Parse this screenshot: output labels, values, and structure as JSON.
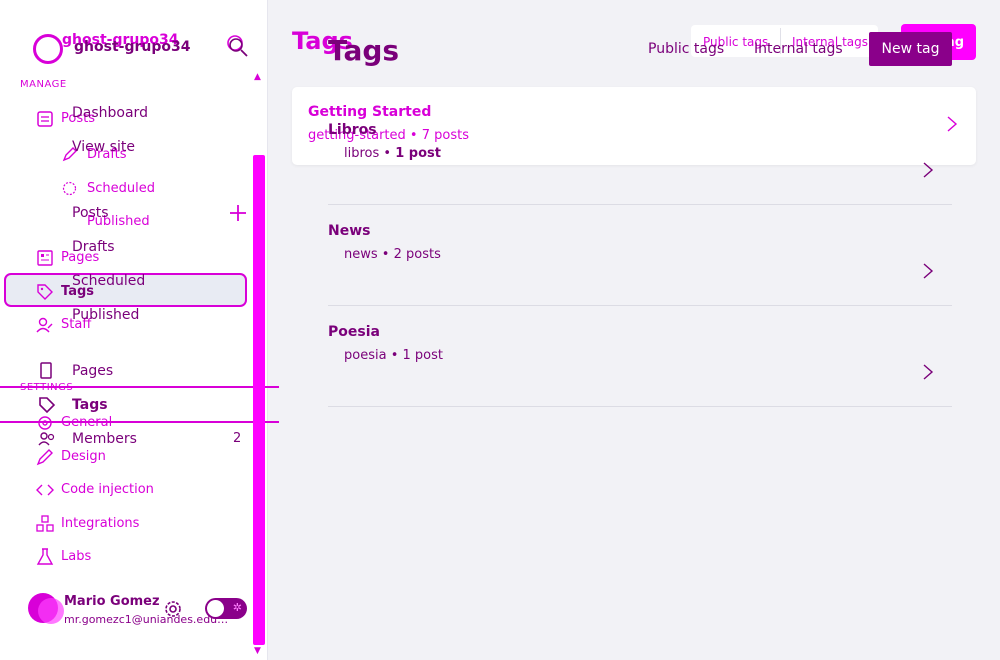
{
  "sidebar": {
    "site_title_a": "ghost-grupo34",
    "site_title_b": "ghost-grupo34",
    "manage_label": "MANAGE",
    "settings_label": "SETTINGS",
    "layer_a_items": [
      "Posts",
      "Drafts",
      "Scheduled",
      "Published",
      "Pages",
      "Tags",
      "Staff"
    ],
    "layer_b_items": [
      "Dashboard",
      "View site",
      "Posts",
      "Drafts",
      "Scheduled",
      "Published",
      "Pages",
      "Tags",
      "Members"
    ],
    "members_count": "2",
    "settings_items": [
      "General",
      "Design",
      "Code injection",
      "Integrations",
      "Labs"
    ],
    "user": {
      "name": "Mario Gomez",
      "email": "mr.gomezc1@uniandes.edu.co"
    }
  },
  "header": {
    "title_a": "Tags",
    "title_b": "Tags",
    "filter_a": [
      "Public tags",
      "Internal tags"
    ],
    "filter_b": [
      "Public tags",
      "Internal tags"
    ],
    "new_tag_a": "New tag",
    "new_tag_b": "New tag"
  },
  "tags_a": [
    {
      "name": "Getting Started",
      "slug": "getting-started",
      "count": "7 posts"
    }
  ],
  "tags_b": [
    {
      "name": "Libros",
      "slug": "libros",
      "count": "1 post"
    },
    {
      "name": "News",
      "slug": "news",
      "count": "2 posts"
    },
    {
      "name": "Poesia",
      "slug": "poesia",
      "count": "1 post"
    }
  ],
  "colors": {
    "accent_bright": "#ff00ff",
    "accent_dark": "#8a008a",
    "background": "#f2f2f6"
  }
}
